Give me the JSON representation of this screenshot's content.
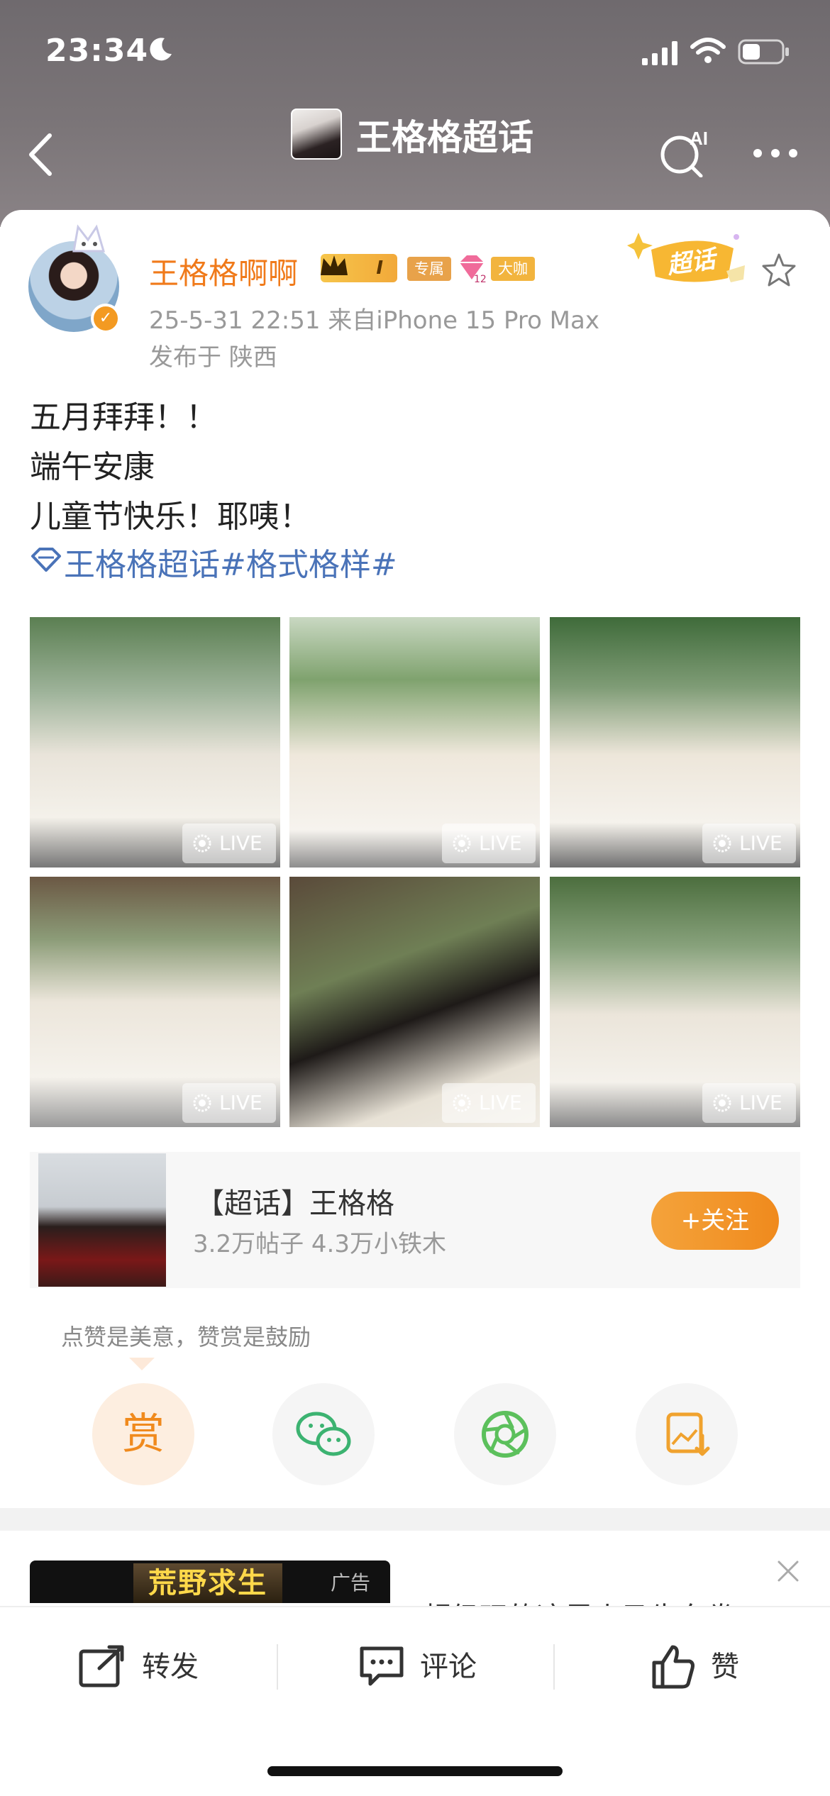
{
  "status_bar": {
    "time": "23:34"
  },
  "header": {
    "title": "王格格超话",
    "ai_label": "AI"
  },
  "post": {
    "username": "王格格啊啊",
    "level_badge": "I",
    "badge_exclusive": "专属",
    "badge_gem_level": "12",
    "badge_bigshot": "大咖",
    "supertopic_tag": "超话",
    "timestamp_source": "25-5-31 22:51  来自iPhone 15 Pro Max",
    "location": "发布于 陕西",
    "lines": [
      "五月拜拜！！",
      "端午安康",
      "儿童节快乐！耶咦！"
    ],
    "hashtag": "王格格超话#格式格样#",
    "photos": [
      {
        "live": "LIVE"
      },
      {
        "live": "LIVE"
      },
      {
        "live": "LIVE"
      },
      {
        "live": "LIVE"
      },
      {
        "live": "LIVE"
      },
      {
        "live": "LIVE"
      }
    ]
  },
  "topic_card": {
    "title": "【超话】王格格",
    "subtitle": "3.2万帖子 4.3万小铁木",
    "follow_label": "+关注"
  },
  "reward": {
    "hint": "点赞是美意，赞赏是鼓励",
    "reward_glyph": "赏"
  },
  "ad": {
    "game_title": "荒野求生",
    "label": "广告",
    "text": "超级玩的这里小马牛东卷"
  },
  "bottom_bar": {
    "repost": "转发",
    "comment": "评论",
    "like": "赞"
  },
  "colors": {
    "accent_orange": "#f08a1d",
    "link_blue": "#4a73b8",
    "username_orange": "#f07a1a"
  }
}
